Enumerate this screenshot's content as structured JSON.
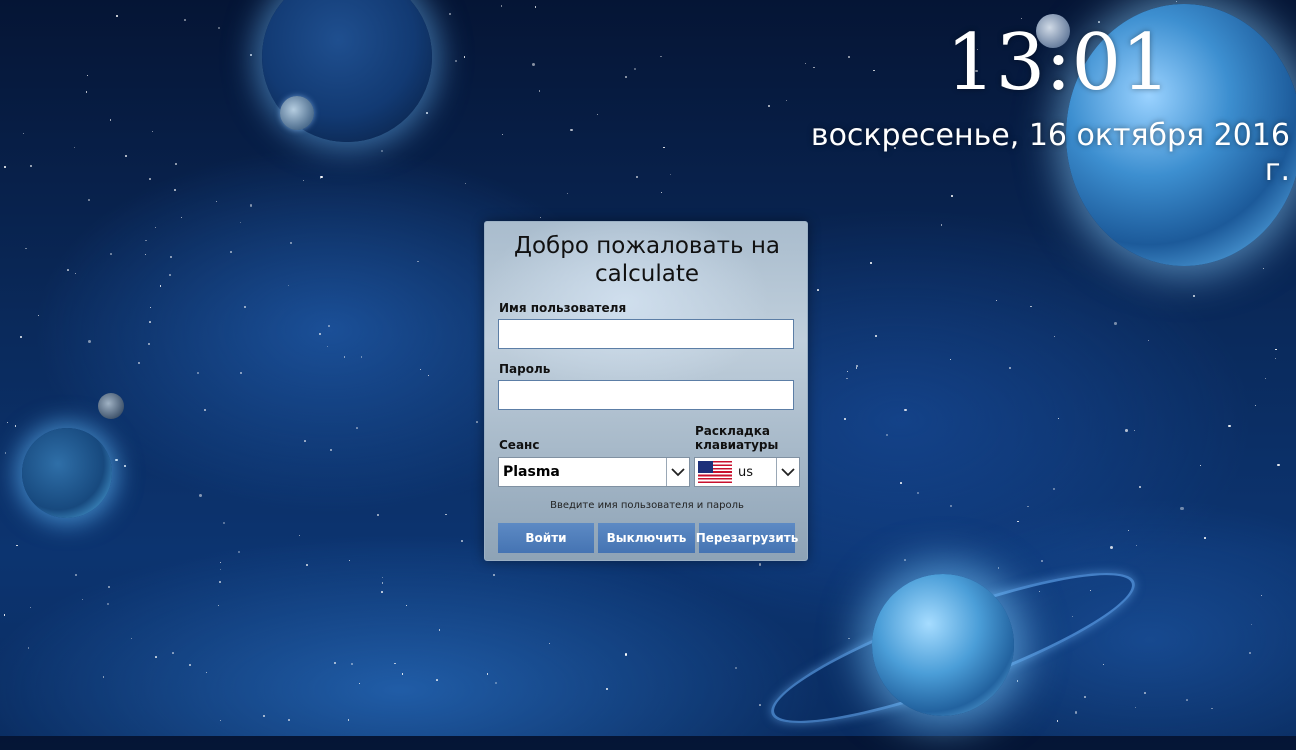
{
  "clock": {
    "time": "13:01",
    "date": "воскресенье, 16 октября 2016 г."
  },
  "login": {
    "welcome": "Добро пожаловать на calculate",
    "username_label": "Имя пользователя",
    "username_value": "",
    "password_label": "Пароль",
    "password_value": "",
    "session_label": "Сеанс",
    "session_value": "Plasma",
    "layout_label": "Раскладка клавиатуры",
    "layout_value": "us",
    "layout_flag_icon": "us-flag-icon",
    "hint": "Введите имя пользователя и пароль",
    "buttons": {
      "login": "Войти",
      "shutdown": "Выключить",
      "reboot": "Перезагрузить"
    }
  },
  "colors": {
    "button": "#4f7fbd",
    "field_border": "#5c7ea6",
    "text": "#ffffff"
  }
}
